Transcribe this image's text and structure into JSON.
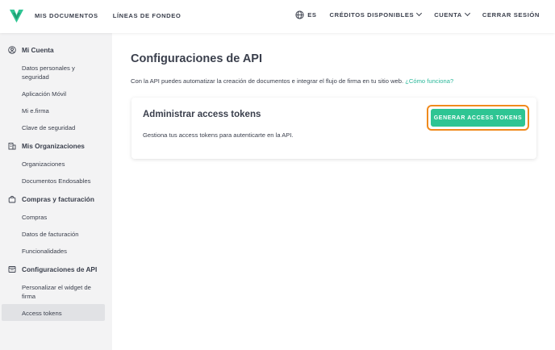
{
  "nav": {
    "my_documents": "MIS DOCUMENTOS",
    "funding_lines": "LÍNEAS DE FONDEO",
    "language": "ES",
    "credits": "CRÉDITOS DISPONIBLES",
    "account": "CUENTA",
    "logout": "CERRAR SESIÓN"
  },
  "sidebar": {
    "sections": [
      {
        "icon": "user-circle-icon",
        "title": "Mi Cuenta",
        "items": [
          "Datos personales y seguridad",
          "Aplicación Móvil",
          "Mi e.firma",
          "Clave de seguridad"
        ]
      },
      {
        "icon": "building-icon",
        "title": "Mis Organizaciones",
        "items": [
          "Organizaciones",
          "Documentos Endosables"
        ]
      },
      {
        "icon": "shopping-bag-icon",
        "title": "Compras y facturación",
        "items": [
          "Compras",
          "Datos de facturación",
          "Funcionalidades"
        ]
      },
      {
        "icon": "api-window-icon",
        "title": "Configuraciones de API",
        "items": [
          "Personalizar el widget de firma",
          "Access tokens"
        ]
      }
    ],
    "active_item": "Access tokens"
  },
  "main": {
    "title": "Configuraciones de API",
    "intro_text": "Con la API puedes automatizar la creación de documentos e integrar el flujo de firma en tu sitio web.",
    "intro_link": "¿Cómo funciona?",
    "card": {
      "title": "Administrar access tokens",
      "description": "Gestiona tus access tokens para autenticarte en la API.",
      "button_label": "GENERAR ACCESS TOKENS"
    }
  },
  "colors": {
    "accent": "#2ec593",
    "link": "#2bb89a",
    "highlight": "#f08a1d",
    "text": "#3a3f4c",
    "sidebar_bg": "#f3f3f4"
  }
}
